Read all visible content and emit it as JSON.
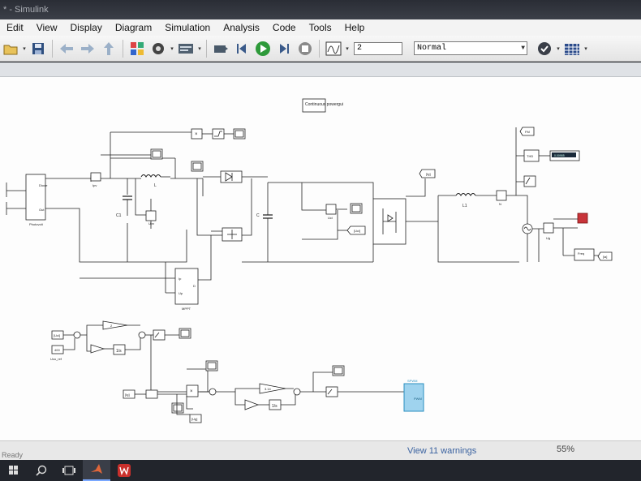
{
  "window": {
    "title": "* - Simulink"
  },
  "menu": [
    "Edit",
    "View",
    "Display",
    "Diagram",
    "Simulation",
    "Analysis",
    "Code",
    "Tools",
    "Help"
  ],
  "toolbar": {
    "stop_time": "2",
    "sim_mode": "Normal",
    "icons": [
      "open-icon",
      "save-icon",
      "back-icon",
      "forward-icon",
      "up-icon",
      "library-icon",
      "settings-icon",
      "model-config-icon",
      "build-icon",
      "step-back-icon",
      "run-icon",
      "step-forward-icon",
      "stop-icon",
      "scope-icon",
      "check-icon",
      "grid-icon"
    ]
  },
  "diagram": {
    "blocks": {
      "powergui": "Continuous powergui",
      "pv_label": "Photovolt",
      "pv_port_top": "Diode",
      "pv_port_bottom": "Out",
      "ipv": "Ipv",
      "upv": "Upv",
      "l": "L",
      "c1": "C1",
      "c": "C",
      "l1": "L1",
      "uci": "Uci",
      "mppt": "MPPT",
      "mppt_in1": "Ip",
      "mppt_in2": "Up",
      "mppt_out": "D",
      "thd": "THD",
      "thd_display": "0.00985",
      "ug": "Ug",
      "goto_ig": "[Ig]",
      "from_ug": "[Ug]",
      "freq": "Freq",
      "goto_ia": "[ia]",
      "pwm": "PWM",
      "spwm": "SPWM",
      "gain_2": "2",
      "gain_314": "3.14",
      "from_uci": "[Uci]",
      "from_ig": "[Ig]",
      "sub_label": "Ucu_ref",
      "const_400": "400"
    }
  },
  "status": {
    "left": "Ready",
    "warnings": "View 11 warnings",
    "zoom": "55%"
  },
  "taskbar": [
    "start-icon",
    "search-icon",
    "task-view-icon",
    "matlab-icon",
    "wps-icon"
  ]
}
